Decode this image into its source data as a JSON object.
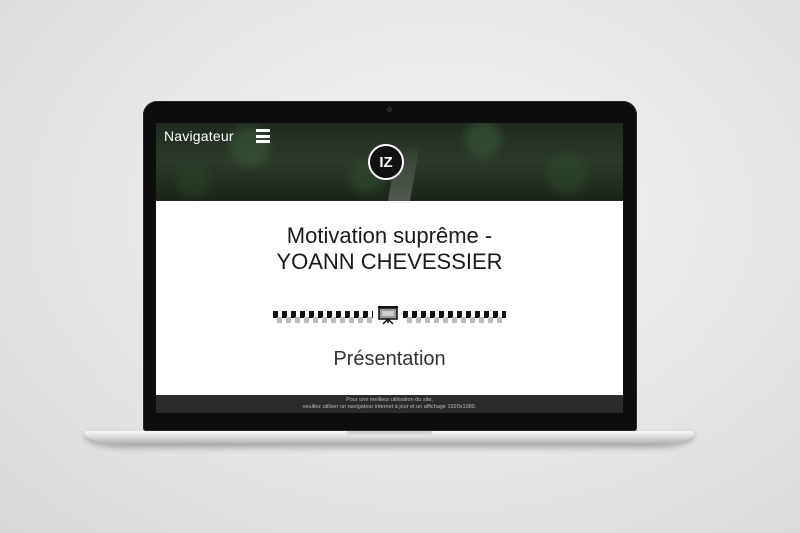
{
  "navbar": {
    "title": "Navigateur",
    "menu_icon": "hamburger-menu-icon"
  },
  "hero": {
    "logo_text": "IZ"
  },
  "main": {
    "title_line1": "Motivation suprême -",
    "title_line2": "YOANN CHEVESSIER",
    "divider_icon": "presentation-board-icon",
    "section_heading": "Présentation"
  },
  "footer": {
    "line1": "Pour une meilleur utilisation du site,",
    "line2": "veuillez utiliser un navigateur internet à jour et un affichage 1920x1080."
  }
}
